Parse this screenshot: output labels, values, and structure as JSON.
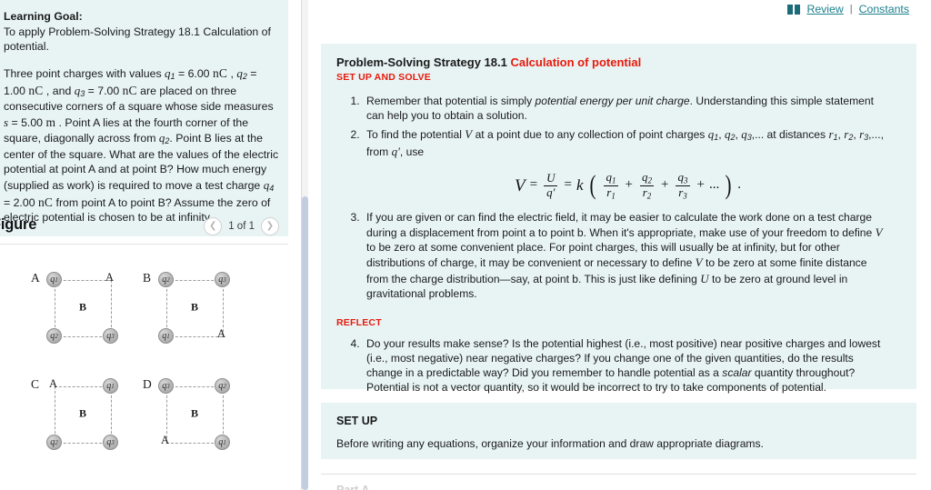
{
  "left_panel": {
    "learning_goal_label": "Learning Goal:",
    "learning_goal_text": "To apply Problem-Solving Strategy 18.1 Calculation of potential.",
    "problem_text_parts": {
      "p1": "Three point charges with values ",
      "q1": "q",
      "q1sub": "1",
      "eq1": " = 6.00 ",
      "u1": "nC",
      "p2": " , ",
      "q2": "q",
      "q2sub": "2",
      "eq2": " = 1.00 ",
      "u2": "nC",
      "p3": " , and ",
      "q3": "q",
      "q3sub": "3",
      "eq3": " = 7.00 ",
      "u3": "nC",
      "p4": " are placed on three consecutive corners of a square whose side measures ",
      "s": "s",
      "eqs": " = 5.00 ",
      "us": "m",
      "p5": " . Point A lies at the fourth corner of the square, diagonally across from ",
      "q2b": "q",
      "q2bsub": "2",
      "p6": ". Point B lies at the center of the square. What are the values of the electric potential at point A and at point B? How much energy (supplied as work) is required to move a test charge ",
      "q4": "q",
      "q4sub": "4",
      "eq4": " = 2.00 ",
      "u4": "nC",
      "p7": " from point A to point B? Assume the zero of electric potential is chosen to be at infinity."
    },
    "figure": {
      "title": "Figure",
      "prev_icon": "chevron-left-icon",
      "next_icon": "chevron-right-icon",
      "counter": "1 of 1",
      "diagrams": [
        {
          "letter": "A",
          "corners": {
            "top_left": "q1",
            "top_right": "A",
            "bottom_left": "q2",
            "bottom_right": "q3"
          },
          "center_label": "B"
        },
        {
          "letter": "B",
          "corners": {
            "top_left": "q2",
            "top_right": "q3",
            "bottom_left": "q1",
            "bottom_right": "A"
          },
          "center_label": "B"
        },
        {
          "letter": "C",
          "corners": {
            "top_left": "A",
            "top_right": "q1",
            "bottom_left": "q2",
            "bottom_right": "q3"
          },
          "center_label": "B"
        },
        {
          "letter": "D",
          "corners": {
            "top_left": "q3",
            "top_right": "q2",
            "bottom_left": "A",
            "bottom_right": "q1"
          },
          "center_label": "B"
        }
      ]
    }
  },
  "right_panel": {
    "top_links": {
      "book_icon": "book-icon",
      "review_label": "Review",
      "separator": "|",
      "constants_label": "Constants"
    },
    "strategy_card": {
      "title_black": "Problem-Solving Strategy 18.1 ",
      "title_red": "Calculation of potential",
      "setup_solve_label": "SET UP AND SOLVE",
      "step1": {
        "pre": "Remember that potential is simply ",
        "italic": "potential energy per unit charge",
        "post": ". Understanding this simple statement can help you to obtain a solution."
      },
      "step2": {
        "a": "To find the potential ",
        "V": "V",
        "b": " at a point due to any collection of point charges ",
        "c": ", ",
        "q1": "q",
        "q1s": "1",
        "q2": "q",
        "q2s": "2",
        "q3": "q",
        "q3s": "3",
        "ellipsis1": ",... at distances ",
        "r1": "r",
        "r1s": "1",
        "r2": "r",
        "r2s": "2",
        "r3": "r",
        "r3s": "3",
        "ellipsis2": ",..., from ",
        "qprime": "q′",
        "end": ", use"
      },
      "equation": {
        "lhs": "V",
        "eq1": "=",
        "frac1_num": "U",
        "frac1_den": "q′",
        "eq2": "=",
        "k": "k",
        "t1_num": "q",
        "t1_num_sub": "1",
        "t1_den": "r",
        "t1_den_sub": "1",
        "plus1": "+",
        "t2_num": "q",
        "t2_num_sub": "2",
        "t2_den": "r",
        "t2_den_sub": "2",
        "plus2": "+",
        "t3_num": "q",
        "t3_num_sub": "3",
        "t3_den": "r",
        "t3_den_sub": "3",
        "plus3": "+",
        "dots": "...",
        "period": "."
      },
      "step3": {
        "a": "If you are given or can find the electric field, it may be easier to calculate the work done on a test charge during a displacement from point a to point b. When it's appropriate, make use of your freedom to define ",
        "V1": "V",
        "b": " to be zero at some convenient place. For point charges, this will usually be at infinity, but for other distributions of charge, it may be convenient or necessary to define ",
        "V2": "V",
        "c": " to be zero at some finite distance from the charge distribution—say, at point b. This is just like defining ",
        "U": "U",
        "d": " to be zero at ground level in gravitational problems."
      },
      "reflect_label": "REFLECT",
      "step4": {
        "a": "Do your results make sense? Is the potential highest (i.e., most positive) near positive charges and lowest (i.e., most negative) near negative charges? If you change one of the given quantities, do the results change in a predictable way? Did you remember to handle potential as a ",
        "italic": "scalar",
        "b": " quantity throughout? Potential is not a vector quantity, so it would be incorrect to try to take components of potential."
      }
    },
    "setup_card": {
      "title": "SET UP",
      "body": "Before writing any equations, organize your information and draw appropriate diagrams."
    },
    "cut_off_label": "Part A"
  },
  "colors": {
    "card_background": "#e8f4f4",
    "accent_red": "#e8190c",
    "link_teal": "#1b7f8c",
    "scrollbar_thumb": "#c2cde0"
  }
}
